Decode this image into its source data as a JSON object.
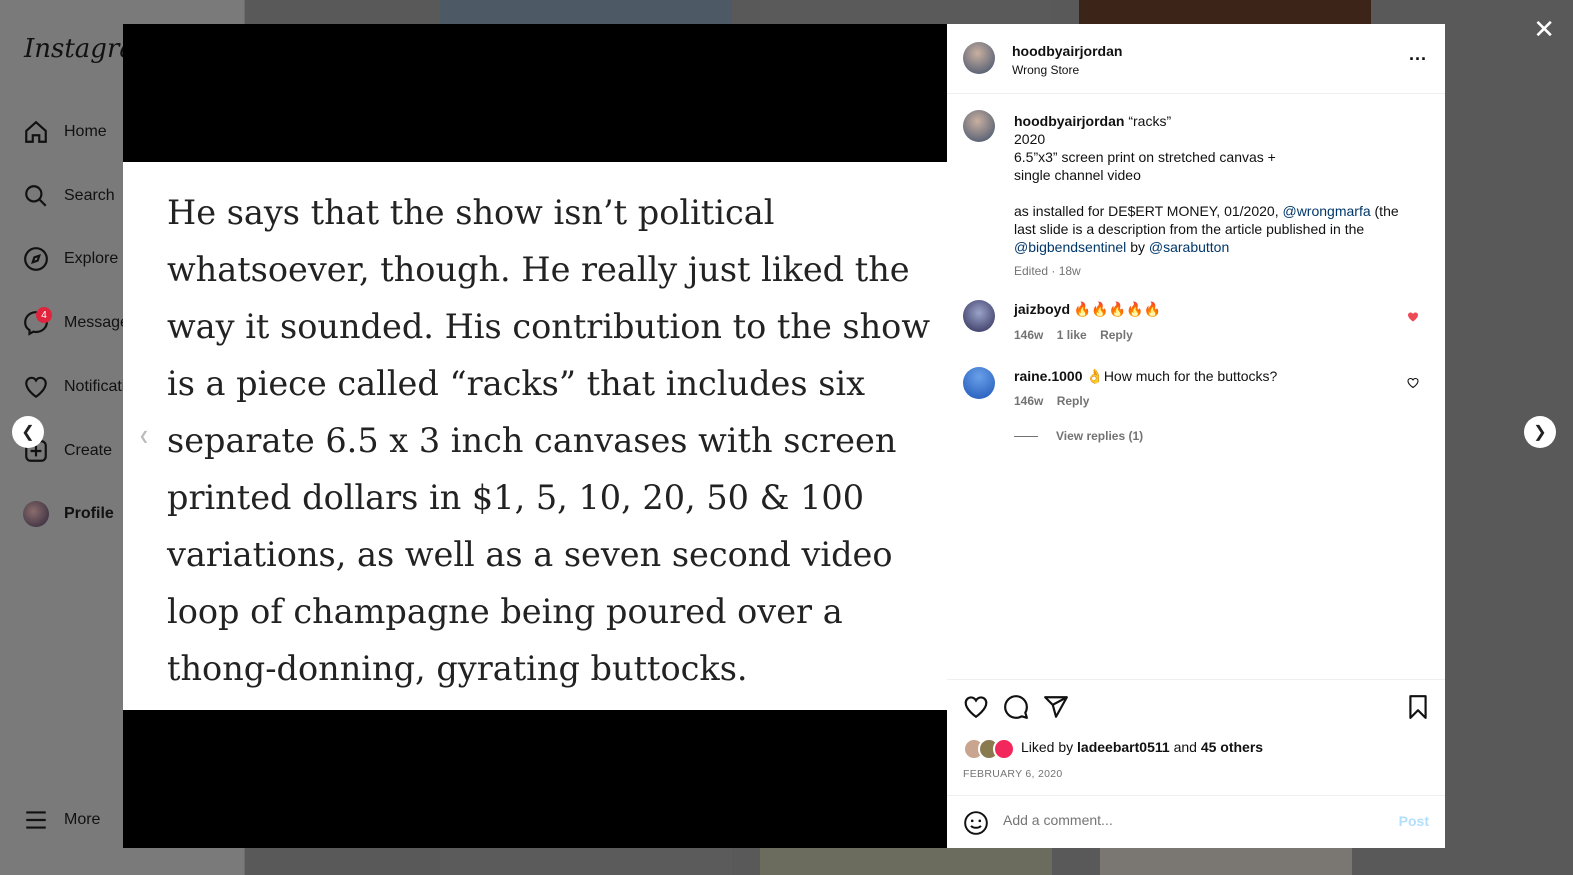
{
  "sidebar": {
    "logo": "Instagram",
    "items": [
      {
        "label": "Home",
        "icon": "home-icon"
      },
      {
        "label": "Search",
        "icon": "search-icon"
      },
      {
        "label": "Explore",
        "icon": "compass-icon"
      },
      {
        "label": "Messages",
        "icon": "messenger-icon",
        "badge": "4"
      },
      {
        "label": "Notifications",
        "icon": "heart-icon"
      },
      {
        "label": "Create",
        "icon": "plus-square-icon"
      },
      {
        "label": "Profile",
        "icon": "avatar"
      }
    ],
    "more": "More"
  },
  "media": {
    "article_lines": [
      "He says that the show isn’t political",
      "whatsoever, though. He really just liked the",
      "way it sounded. His contribution to the show",
      "is a piece called “racks” that includes six",
      "separate 6.5 x 3 inch canvases with screen",
      "printed dollars in $1, 5, 10, 20, 50 & 100",
      "variations, as well as a seven second video",
      "loop of champagne being poured over a",
      "thong-donning, gyrating buttocks."
    ]
  },
  "post": {
    "username": "hoodbyairjordan",
    "location": "Wrong Store",
    "more": "...",
    "caption": {
      "username": "hoodbyairjordan",
      "line1": "“racks”",
      "line2": "2020",
      "line3": "6.5”x3” screen print on stretched canvas +",
      "line4": "single channel video",
      "line5a": "as installed for DE$ERT MONEY, 01/2020,",
      "mention1": "@wrongmarfa",
      "line5b": "(the",
      "line6": "last slide is a description from the article published in the",
      "mention2": "@bigbendsentinel",
      "by": "by",
      "mention3": "@sarabutton",
      "meta": "Edited · 18w"
    },
    "comments": [
      {
        "username": "jaizboyd",
        "text": "🔥🔥🔥🔥🔥",
        "time": "146w",
        "likes": "1 like",
        "reply": "Reply",
        "liked": true
      },
      {
        "username": "raine.1000",
        "text": "👌How much for the buttocks?",
        "time": "146w",
        "reply": "Reply",
        "view_replies": "View replies (1)",
        "liked": false
      }
    ],
    "likes": {
      "prefix": "Liked by",
      "user": "ladeebart0511",
      "and": "and",
      "others": "45 others"
    },
    "date": "FEBRUARY 6, 2020",
    "add_comment_placeholder": "Add a comment...",
    "post_button": "Post"
  },
  "overlay": {
    "close": "✕"
  },
  "colors": {
    "like_red": "#ed4956",
    "link": "#00376b",
    "post_btn": "#b2dffc"
  }
}
